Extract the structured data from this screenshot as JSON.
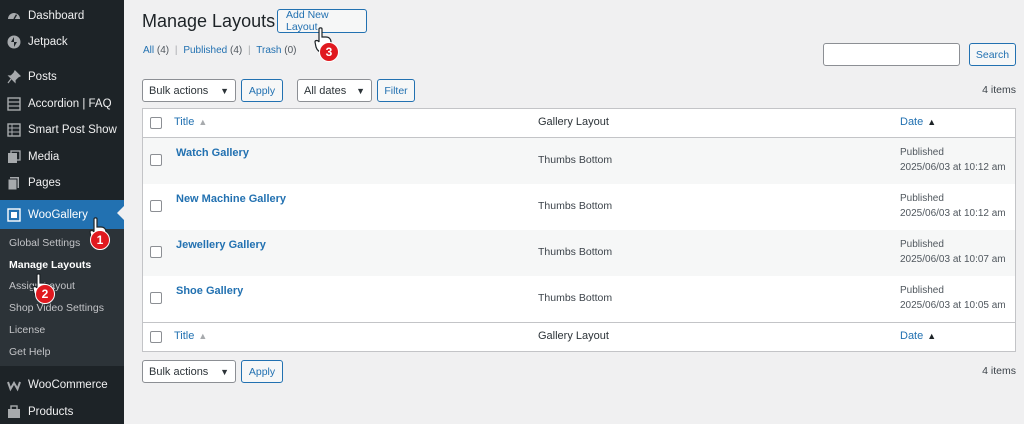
{
  "sidebar": {
    "items": [
      {
        "label": "Dashboard",
        "icon": "dashboard-icon"
      },
      {
        "label": "Jetpack",
        "icon": "jetpack-icon"
      },
      {
        "label": "Posts",
        "icon": "pin-icon"
      },
      {
        "label": "Accordion | FAQ",
        "icon": "list-icon"
      },
      {
        "label": "Smart Post Show",
        "icon": "grid-icon"
      },
      {
        "label": "Media",
        "icon": "media-icon"
      },
      {
        "label": "Pages",
        "icon": "page-icon"
      },
      {
        "label": "WooGallery",
        "icon": "gallery-icon"
      },
      {
        "label": "WooCommerce",
        "icon": "woocommerce-icon"
      },
      {
        "label": "Products",
        "icon": "products-icon"
      }
    ],
    "submenu": [
      {
        "label": "Global Settings"
      },
      {
        "label": "Manage Layouts"
      },
      {
        "label": "Assign Layout"
      },
      {
        "label": "Shop Video Settings"
      },
      {
        "label": "License"
      },
      {
        "label": "Get Help"
      }
    ]
  },
  "header": {
    "title": "Manage Layouts",
    "add_new_label": "Add New Layout"
  },
  "filters": {
    "all_label": "All",
    "all_count": "(4)",
    "published_label": "Published",
    "published_count": "(4)",
    "trash_label": "Trash",
    "trash_count": "(0)"
  },
  "search": {
    "value": "",
    "button_label": "Search"
  },
  "tablenav": {
    "bulk_actions": "Bulk actions",
    "apply_label": "Apply",
    "dates": "All dates",
    "filter_label": "Filter",
    "items_count": "4 items"
  },
  "table": {
    "columns": {
      "title": "Title",
      "gallery_layout": "Gallery Layout",
      "date": "Date"
    },
    "rows": [
      {
        "title": "Watch Gallery",
        "layout": "Thumbs Bottom",
        "status": "Published",
        "date": "2025/06/03 at 10:12 am"
      },
      {
        "title": "New Machine Gallery",
        "layout": "Thumbs Bottom",
        "status": "Published",
        "date": "2025/06/03 at 10:12 am"
      },
      {
        "title": "Jewellery Gallery",
        "layout": "Thumbs Bottom",
        "status": "Published",
        "date": "2025/06/03 at 10:07 am"
      },
      {
        "title": "Shoe Gallery",
        "layout": "Thumbs Bottom",
        "status": "Published",
        "date": "2025/06/03 at 10:05 am"
      }
    ]
  },
  "annotations": {
    "step1": "1",
    "step2": "2",
    "step3": "3"
  },
  "colors": {
    "sidebar_bg": "#1d2327",
    "accent": "#2271b1",
    "annotation_red": "#e0191f"
  }
}
